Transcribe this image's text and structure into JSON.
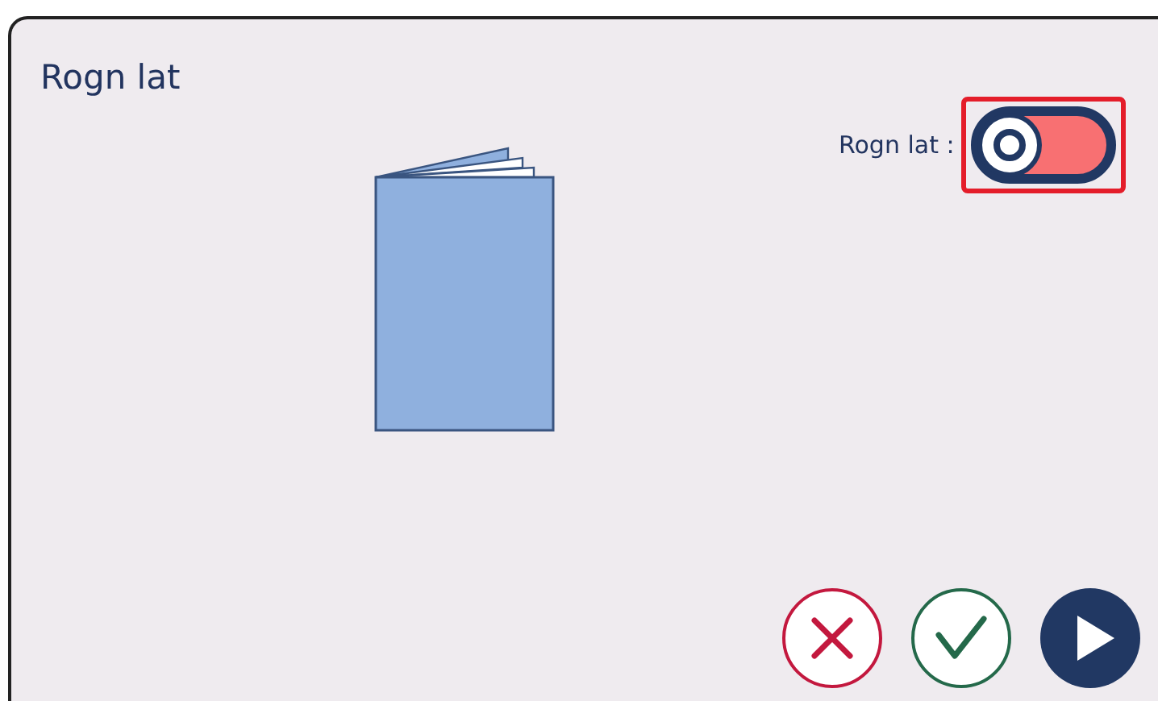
{
  "dialog": {
    "title": "Rogn lat"
  },
  "toggle": {
    "label": "Rogn lat :",
    "on": false,
    "highlighted": true
  },
  "buttons": [
    {
      "kind": "cancel"
    },
    {
      "kind": "confirm"
    },
    {
      "kind": "next"
    }
  ]
}
